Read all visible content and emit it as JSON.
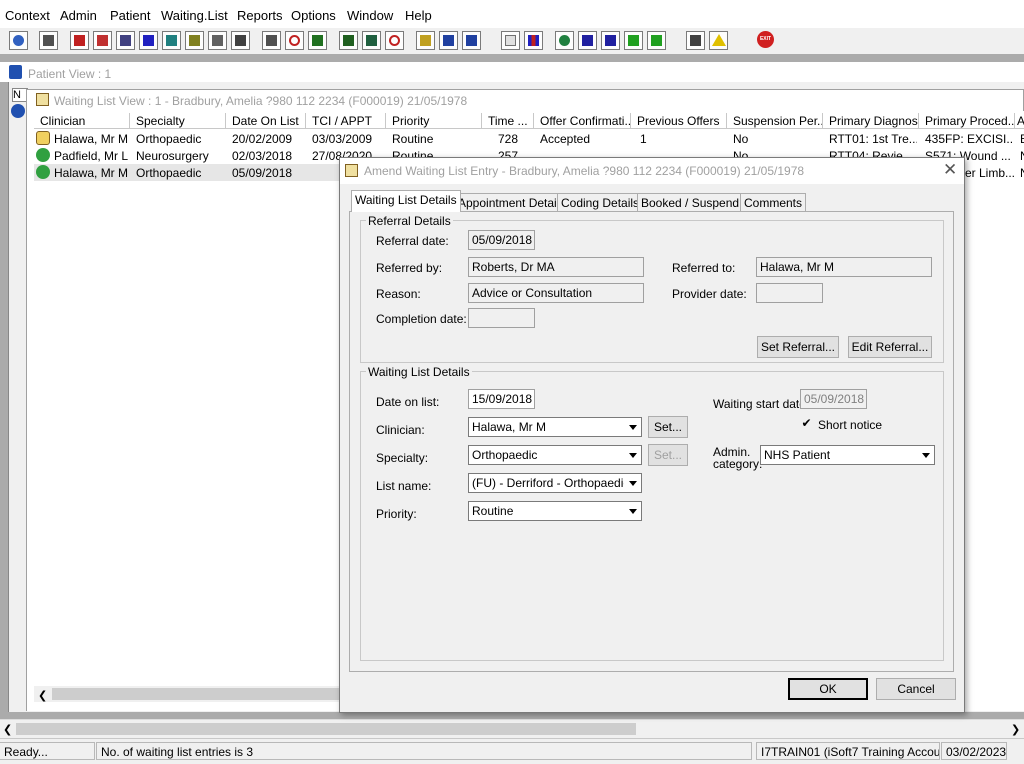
{
  "menu": [
    "Context",
    "Admin",
    "Patient",
    "Waiting.List",
    "Reports",
    "Options",
    "Window",
    "Help"
  ],
  "toolbar_icons": [
    "user-icon",
    "printer-icon",
    "book-icon",
    "edit-icon",
    "form-icon",
    "mail-icon",
    "person-icon",
    "notes-icon",
    "card-icon",
    "camera-icon",
    "scissors-icon",
    "clock-icon",
    "monitor-icon",
    "screen-icon",
    "chat-icon",
    "chart-icon",
    "list-icon",
    "stack-icon",
    "upload-icon",
    "document-icon",
    "bar-chart-icon",
    "globe-icon",
    "check-list-icon",
    "check-list-icon",
    "download-icon",
    "approve-icon",
    "swap-icon",
    "warning-icon",
    "exit-icon"
  ],
  "exit_label": "EXIT",
  "patient_view": {
    "title": "Patient View : 1"
  },
  "waiting_list_view": {
    "title": "Waiting List View :  1 - Bradbury, Amelia ?980 112 2234 (F000019) 21/05/1978",
    "columns": [
      "Clinician",
      "Specialty",
      "Date On List",
      "TCI / APPT",
      "Priority",
      "Time ...",
      "Offer Confirmati...",
      "Previous Offers",
      "Suspension Per...",
      "Primary Diagnosis",
      "Primary Proced...",
      "A"
    ],
    "rows": [
      {
        "clinician": "Halawa, Mr M",
        "specialty": "Orthopaedic",
        "date_on_list": "20/02/2009",
        "tci": "03/03/2009",
        "priority": "Routine",
        "time": "728",
        "offer": "Accepted",
        "prev_offers": "1",
        "suspension": "No",
        "diagnosis": "RTT01: 1st Tre...",
        "procedure": "435FP: EXCISI...",
        "extra": "E"
      },
      {
        "clinician": "Padfield, Mr L",
        "specialty": "Neurosurgery",
        "date_on_list": "02/03/2018",
        "tci": "27/08/2020",
        "priority": "Routine",
        "time": "257",
        "offer": "",
        "prev_offers": "",
        "suspension": "No",
        "diagnosis": "RTT04: Revie...",
        "procedure": "S571: Wound ...",
        "extra": "N"
      },
      {
        "clinician": "Halawa, Mr M",
        "specialty": "Orthopaedic",
        "date_on_list": "05/09/2018",
        "tci": "",
        "priority": "",
        "time": "",
        "offer": "",
        "prev_offers": "",
        "suspension": "",
        "diagnosis": "",
        "procedure": "er Limb...",
        "extra": "N"
      }
    ],
    "row_highlight": "#e6e6e6"
  },
  "dialog": {
    "title": "Amend Waiting List Entry - Bradbury, Amelia ?980 112 2234 (F000019) 21/05/1978",
    "tabs": [
      "Waiting List Details",
      "Appointment Details",
      "Coding Details",
      "Booked / Suspend",
      "Comments"
    ],
    "referral": {
      "group_label": "Referral Details",
      "referral_date_label": "Referral date:",
      "referral_date": "05/09/2018",
      "referred_by_label": "Referred by:",
      "referred_by": "Roberts, Dr MA",
      "referred_to_label": "Referred to:",
      "referred_to": "Halawa, Mr M",
      "reason_label": "Reason:",
      "reason": "Advice or Consultation",
      "provider_date_label": "Provider date:",
      "provider_date": "",
      "completion_date_label": "Completion date:",
      "completion_date": "",
      "set_referral": "Set Referral...",
      "edit_referral": "Edit Referral..."
    },
    "waiting": {
      "group_label": "Waiting List Details",
      "date_on_list_label": "Date on list:",
      "date_on_list": "15/09/2018",
      "waiting_start_label": "Waiting start date:",
      "waiting_start": "05/09/2018",
      "short_notice_label": "Short notice",
      "short_notice_checked": true,
      "clinician_label": "Clinician:",
      "clinician": "Halawa, Mr M",
      "clinician_set": "Set...",
      "specialty_label": "Specialty:",
      "specialty": "Orthopaedic",
      "specialty_set": "Set...",
      "admin_category_label_1": "Admin.",
      "admin_category_label_2": "category:",
      "admin_category": "NHS Patient",
      "list_name_label": "List name:",
      "list_name": "(FU) - Derriford - Orthopaedic OF",
      "priority_label": "Priority:",
      "priority": "Routine"
    },
    "ok": "OK",
    "cancel": "Cancel"
  },
  "status": {
    "ready": "Ready...",
    "entries": "No. of waiting list entries is 3",
    "account": "I7TRAIN01 (iSoft7 Training Account)",
    "date": "03/02/2023"
  }
}
